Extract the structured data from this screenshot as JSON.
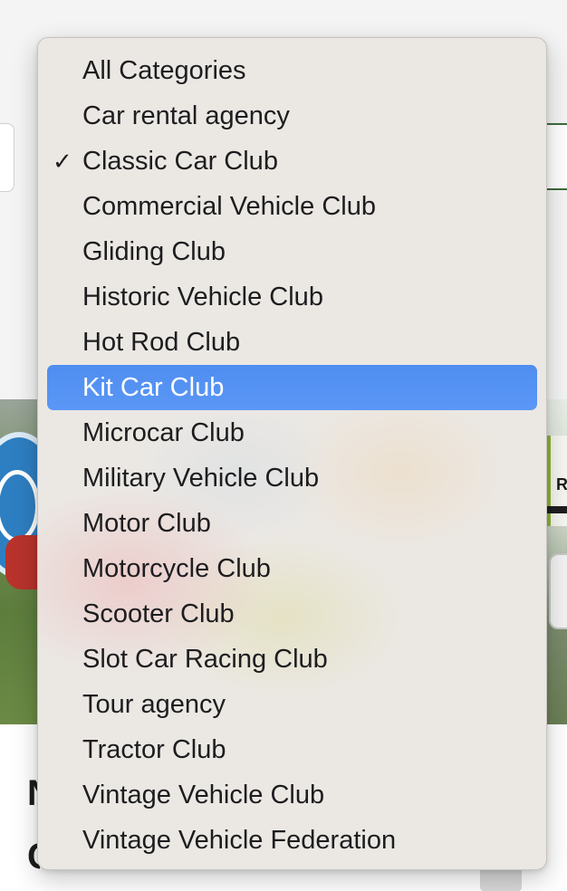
{
  "dropdown": {
    "selected_value": "Classic Car Club",
    "highlighted_value": "Kit Car Club",
    "check_glyph": "✓",
    "options": [
      "All Categories",
      "Car rental agency",
      "Classic Car Club",
      "Commercial Vehicle Club",
      "Gliding Club",
      "Historic Vehicle Club",
      "Hot Rod Club",
      "Kit Car Club",
      "Microcar Club",
      "Military Vehicle Club",
      "Motor Club",
      "Motorcycle Club",
      "Scooter Club",
      "Slot Car Racing Club",
      "Tour agency",
      "Tractor Club",
      "Vintage Vehicle Club",
      "Vintage Vehicle Federation"
    ]
  },
  "background": {
    "sign_letter": "R",
    "heading_fragment_1": "N",
    "heading_fragment_2": "C"
  },
  "colors": {
    "highlight": "#5a97f6",
    "select_border_focus": "#3e6b3a",
    "menu_background": "#ebe8e4"
  }
}
